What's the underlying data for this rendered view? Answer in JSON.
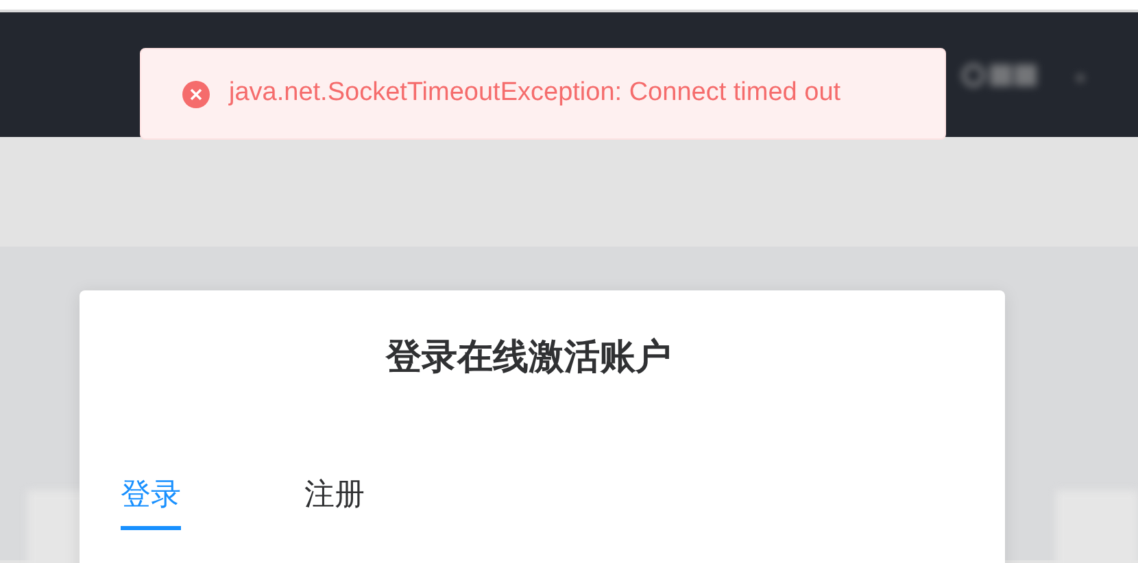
{
  "toast": {
    "kind": "error",
    "message": "java.net.SocketTimeoutException: Connect timed out"
  },
  "dialog": {
    "title": "登录在线激活账户",
    "tabs": [
      {
        "label": "登录",
        "selected": true
      },
      {
        "label": "注册",
        "selected": false
      }
    ]
  }
}
